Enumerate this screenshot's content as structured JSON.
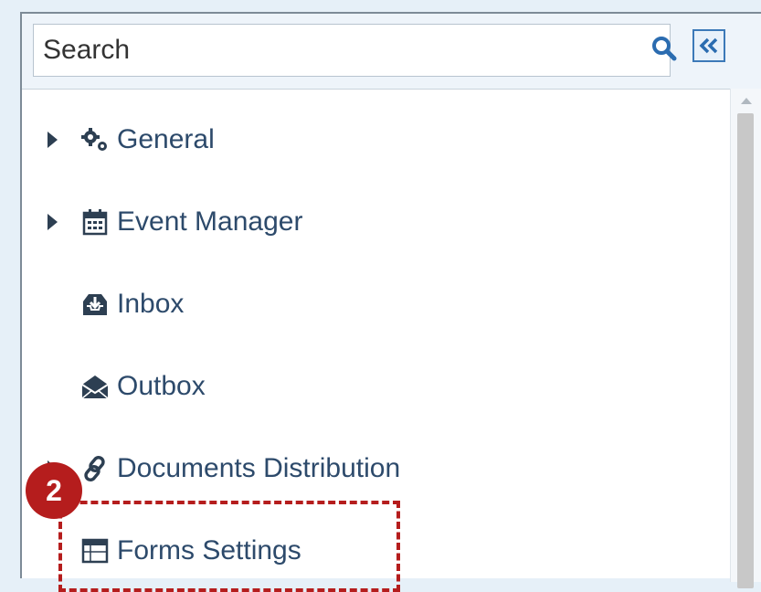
{
  "search": {
    "placeholder": "Search",
    "search_icon": "search-icon",
    "collapse_icon": "double-chevron-left-icon"
  },
  "tree": {
    "items": [
      {
        "label": "General",
        "icon": "gears-icon",
        "expandable": true
      },
      {
        "label": "Event Manager",
        "icon": "calendar-icon",
        "expandable": true
      },
      {
        "label": "Inbox",
        "icon": "inbox-icon",
        "expandable": false
      },
      {
        "label": "Outbox",
        "icon": "envelope-open-icon",
        "expandable": false
      },
      {
        "label": "Documents Distribution",
        "icon": "link-icon",
        "expandable": true
      },
      {
        "label": "Forms Settings",
        "icon": "window-icon",
        "expandable": false
      }
    ]
  },
  "annotation": {
    "badge": "2",
    "color": "#b51d1d"
  },
  "colors": {
    "text": "#2d4a6b",
    "accent": "#3c79b8"
  }
}
